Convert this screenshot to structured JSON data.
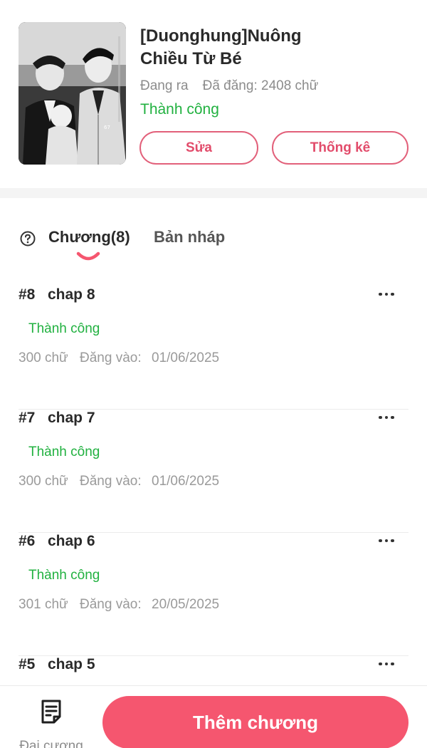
{
  "book": {
    "title_line1": "[Duonghung]Nuông",
    "title_line2": "Chiều Từ Bé",
    "state": "Đang ra",
    "posted": "Đã đăng: 2408 chữ",
    "status": "Thành công",
    "cover_watermark": "67"
  },
  "actions": {
    "edit_label": "Sửa",
    "stats_label": "Thống kê"
  },
  "tabs": [
    {
      "label": "Chương(8)",
      "active": true
    },
    {
      "label": "Bản nháp",
      "active": false
    }
  ],
  "chapters": [
    {
      "number": "#8",
      "title": "chap 8",
      "status": "Thành công",
      "words": "300 chữ",
      "date_label": "Đăng vào:",
      "date": "01/06/2025"
    },
    {
      "number": "#7",
      "title": "chap 7",
      "status": "Thành công",
      "words": "300 chữ",
      "date_label": "Đăng vào:",
      "date": "01/06/2025"
    },
    {
      "number": "#6",
      "title": "chap 6",
      "status": "Thành công",
      "words": "301 chữ",
      "date_label": "Đăng vào:",
      "date": "20/05/2025"
    },
    {
      "number": "#5",
      "title": "chap 5",
      "status": "",
      "words": "",
      "date_label": "",
      "date": ""
    }
  ],
  "bottom": {
    "outline_label": "Đại cương",
    "add_label": "Thêm chương"
  },
  "colors": {
    "accent": "#f5566f",
    "success": "#21b140",
    "pill_border": "#e2607a"
  }
}
